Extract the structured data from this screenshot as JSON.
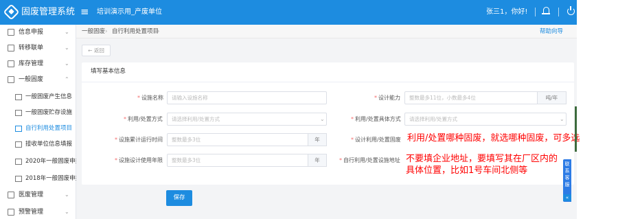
{
  "header": {
    "app_title": "固废管理系统",
    "menu_icon": "≡",
    "unit": "培训演示用_产废单位",
    "greeting": "张三1，你好!",
    "bell_icon": "bell-icon",
    "power_icon": "power-icon"
  },
  "sidebar": {
    "items": [
      {
        "label": "信息申报",
        "chevron": "⌄"
      },
      {
        "label": "转移联单",
        "chevron": "⌄"
      },
      {
        "label": "库存管理",
        "chevron": "⌄"
      },
      {
        "label": "一般固废",
        "chevron": "⌃"
      }
    ],
    "subitems": [
      {
        "label": "一般固废产生信息"
      },
      {
        "label": "一般固废贮存设施"
      },
      {
        "label": "自行利用处置项目"
      },
      {
        "label": "接收单位信息填报"
      },
      {
        "label": "2020年一般固废申报"
      },
      {
        "label": "2018年一般固废申报"
      }
    ],
    "items2": [
      {
        "label": "医废管理",
        "chevron": "⌄"
      },
      {
        "label": "预警管理",
        "chevron": "⌄"
      }
    ]
  },
  "breadcrumb": {
    "level1": "一般固废",
    "sep": "›",
    "level2": "自行利用处置项目",
    "help": "帮助向导"
  },
  "back_button": "← 返回",
  "form": {
    "title": "填写基本信息",
    "fields": {
      "facility_name": {
        "label": "设施名称",
        "placeholder": "请输入设施名称"
      },
      "design_capacity": {
        "label": "设计能力",
        "placeholder": "整数最多11位，小数最多4位",
        "unit": "吨/年"
      },
      "util_method": {
        "label": "利用/处置方式",
        "placeholder": "请选择利用/处置方式"
      },
      "util_specific": {
        "label": "利用/处置具体方式",
        "placeholder": "请选择利用/处置方式"
      },
      "run_time": {
        "label": "设施累计运行时间",
        "placeholder": "整数最多3位",
        "unit": "年"
      },
      "design_waste": {
        "label": "设计利用/处置固废"
      },
      "design_life": {
        "label": "设施设计使用年限",
        "placeholder": "整数最多3位",
        "unit": "年"
      },
      "site_address": {
        "label": "自行利用/处置设施地址"
      }
    },
    "save_label": "保存"
  },
  "annotations": {
    "waste_note": "利用/处置哪种固废，就选哪种固废，可多选",
    "address_line1": "不要填企业地址，要填写其在厂区内的",
    "address_line2": "具体位置，比如1号车间北侧等"
  },
  "dock": {
    "label": "联系客服",
    "arrow": "«"
  }
}
